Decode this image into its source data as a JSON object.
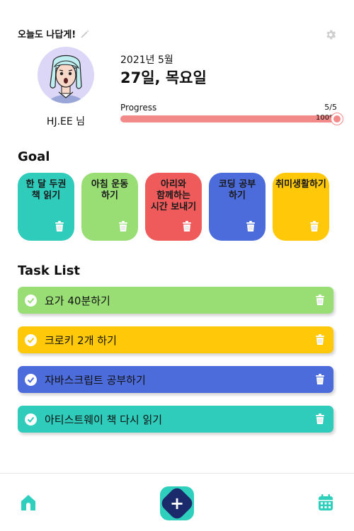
{
  "header": {
    "motto": "오늘도 나답게!"
  },
  "profile": {
    "username": "HJ.EE 님"
  },
  "date": {
    "month_label": "2021년 5월",
    "day_label": "27일, 목요일"
  },
  "progress": {
    "label": "Progress",
    "count": "5/5",
    "percent_label": "100%",
    "fraction": 1.0,
    "color": "#f38a8a"
  },
  "goals": {
    "title": "Goal",
    "items": [
      {
        "label": "한 달 두권 책 읽기",
        "color": "#2fcbbb"
      },
      {
        "label": "아침 운동 하기",
        "color": "#98de75"
      },
      {
        "label": "아리와 함께하는 시간 보내기",
        "color": "#ef5b5b"
      },
      {
        "label": "코딩 공부 하기",
        "color": "#4d6cdc"
      },
      {
        "label": "취미생활하기",
        "color": "#ffc90a"
      }
    ]
  },
  "tasks": {
    "title": "Task List",
    "items": [
      {
        "label": "요가 40분하기",
        "color": "#98de75"
      },
      {
        "label": "크로키 2개 하기",
        "color": "#ffc90a"
      },
      {
        "label": "자바스크립트 공부하기",
        "color": "#4d6cdc"
      },
      {
        "label": "아티스트웨이 책 다시 읽기",
        "color": "#2fcbbb"
      }
    ]
  },
  "nav": {
    "add_symbol": "+"
  },
  "icons": [
    "pencil-icon",
    "gear-icon",
    "trash-icon",
    "check-icon",
    "home-icon",
    "plus-icon",
    "calendar-icon"
  ]
}
